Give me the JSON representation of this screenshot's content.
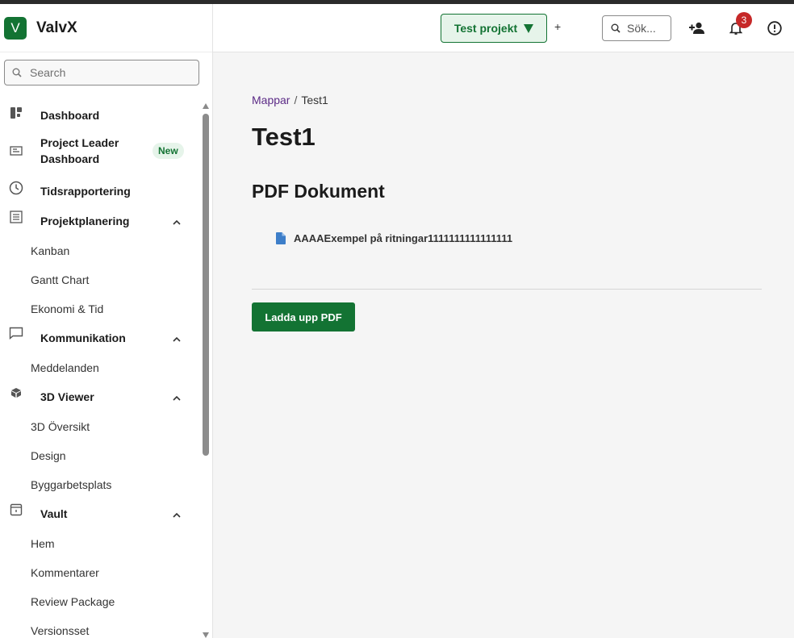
{
  "app": {
    "logo_letter": "V",
    "name": "ValvX",
    "accent": "#137333"
  },
  "sidebar": {
    "search_placeholder": "Search",
    "items": [
      {
        "label": "Dashboard",
        "icon": "dashboard-icon"
      },
      {
        "label": "Project Leader Dashboard",
        "icon": "leader-dashboard-icon",
        "badge": "New"
      },
      {
        "label": "Tidsrapportering",
        "icon": "clock-icon"
      },
      {
        "label": "Projektplanering",
        "icon": "list-icon",
        "expanded": true,
        "children": [
          "Kanban",
          "Gantt Chart",
          "Ekonomi & Tid"
        ]
      },
      {
        "label": "Kommunikation",
        "icon": "chat-icon",
        "expanded": true,
        "children": [
          "Meddelanden"
        ]
      },
      {
        "label": "3D Viewer",
        "icon": "cube-icon",
        "expanded": true,
        "children": [
          "3D Översikt",
          "Design",
          "Byggarbetsplats"
        ]
      },
      {
        "label": "Vault",
        "icon": "vault-icon",
        "expanded": true,
        "children": [
          "Hem",
          "Kommentarer",
          "Review Package",
          "Versionsset"
        ]
      }
    ]
  },
  "header": {
    "project_button": "Test projekt",
    "add_label": "+",
    "search_placeholder": "Sök...",
    "notification_count": "3"
  },
  "main": {
    "breadcrumb": {
      "link": "Mappar",
      "separator": "/",
      "current": "Test1"
    },
    "title": "Test1",
    "section_title": "PDF Dokument",
    "documents": [
      {
        "name": "AAAAExempel på ritningar1111111111111111",
        "icon": "pdf-file-icon"
      }
    ],
    "upload_button": "Ladda upp PDF"
  }
}
